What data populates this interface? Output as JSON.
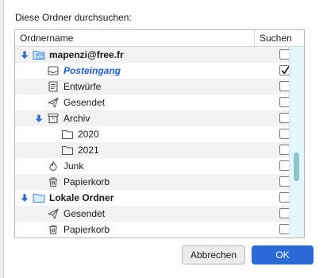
{
  "prompt": "Diese Ordner durchsuchen:",
  "columns": {
    "name": "Ordnername",
    "search": "Suchen"
  },
  "rows": [
    {
      "label": "mapenzi@free.fr",
      "icon": "mail-account-icon",
      "style": "bold",
      "twisty": true,
      "checked": false,
      "level": 0
    },
    {
      "label": "Posteingang",
      "icon": "inbox-icon",
      "style": "blue",
      "twisty": false,
      "checked": true,
      "level": 1
    },
    {
      "label": "Entwürfe",
      "icon": "drafts-icon",
      "style": "normal",
      "twisty": false,
      "checked": false,
      "level": 1
    },
    {
      "label": "Gesendet",
      "icon": "sent-icon",
      "style": "normal",
      "twisty": false,
      "checked": false,
      "level": 1
    },
    {
      "label": "Archiv",
      "icon": "archive-icon",
      "style": "normal",
      "twisty": true,
      "checked": false,
      "level": 1
    },
    {
      "label": "2020",
      "icon": "folder-icon",
      "style": "normal",
      "twisty": false,
      "checked": false,
      "level": 2
    },
    {
      "label": "2021",
      "icon": "folder-icon",
      "style": "normal",
      "twisty": false,
      "checked": false,
      "level": 2
    },
    {
      "label": "Junk",
      "icon": "junk-icon",
      "style": "normal",
      "twisty": false,
      "checked": false,
      "level": 1
    },
    {
      "label": "Papierkorb",
      "icon": "trash-icon",
      "style": "normal",
      "twisty": false,
      "checked": false,
      "level": 1
    },
    {
      "label": "Lokale Ordner",
      "icon": "local-folders-icon",
      "style": "bold",
      "twisty": true,
      "checked": false,
      "level": 0
    },
    {
      "label": "Gesendet",
      "icon": "sent-icon",
      "style": "normal",
      "twisty": false,
      "checked": false,
      "level": 1
    },
    {
      "label": "Papierkorb",
      "icon": "trash-icon",
      "style": "normal",
      "twisty": false,
      "checked": false,
      "level": 1
    }
  ],
  "buttons": {
    "cancel": "Abbrechen",
    "ok": "OK"
  },
  "colors": {
    "accent": "#2a6ad6",
    "link": "#1f5ed8",
    "scrollbar_track": "#e3f6f9",
    "scrollbar_thumb": "#8fc6cc"
  }
}
